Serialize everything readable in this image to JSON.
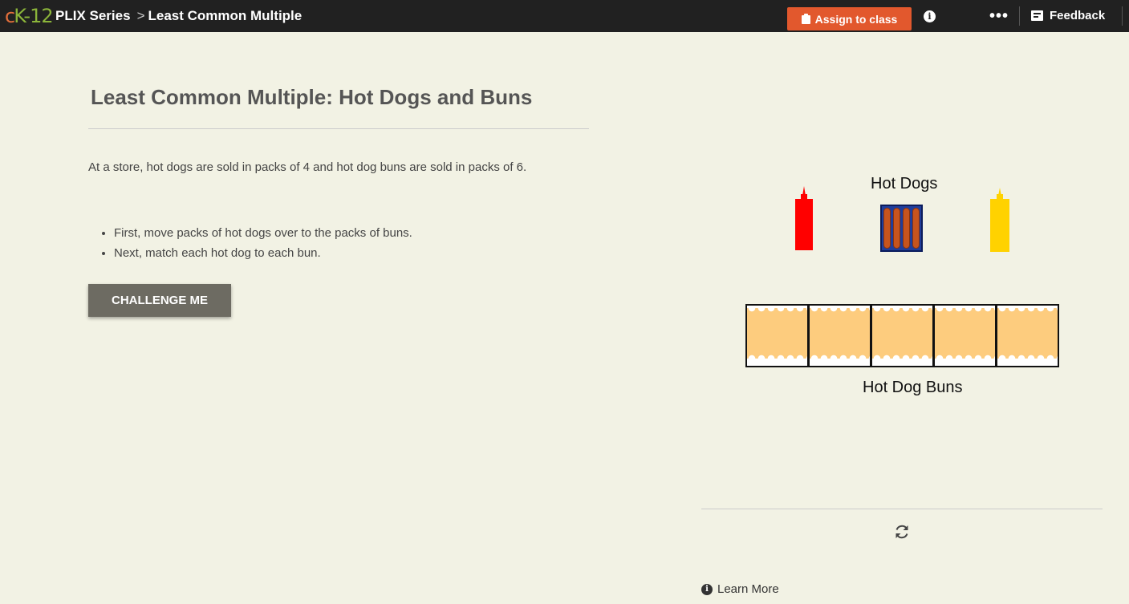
{
  "topbar": {
    "logo_c": "c",
    "logo_k12": "K-12",
    "series": "PLIX Series",
    "separator": ">",
    "page": "Least Common Multiple",
    "assign_label": "Assign to class",
    "info_glyph": "i",
    "more_glyph": "•••",
    "feedback_label": "Feedback",
    "assign_color": "#e2582d"
  },
  "main": {
    "title": "Least Common Multiple: Hot Dogs and Buns",
    "intro": "At a store, hot dogs are sold in packs of 4 and hot dog buns are sold in packs of 6.",
    "steps": [
      "First, move packs of hot dogs over to the packs of buns.",
      "Next, match each hot dog to each bun."
    ],
    "challenge_label": "CHALLENGE ME"
  },
  "interactive": {
    "hotdogs_label": "Hot Dogs",
    "buns_label": "Hot Dog Buns",
    "hotdog_packs": [
      {
        "sausages": 4
      }
    ],
    "bun_pack_count": 5,
    "ketchup_color": "#ff0000",
    "mustard_color": "#ffd200",
    "sausage_color": "#c7541e",
    "pack_color": "#1f3d9c",
    "bun_color": "#fdcc7e"
  },
  "footer": {
    "learn_more_label": "Learn More",
    "reset_icon": "refresh-icon"
  }
}
